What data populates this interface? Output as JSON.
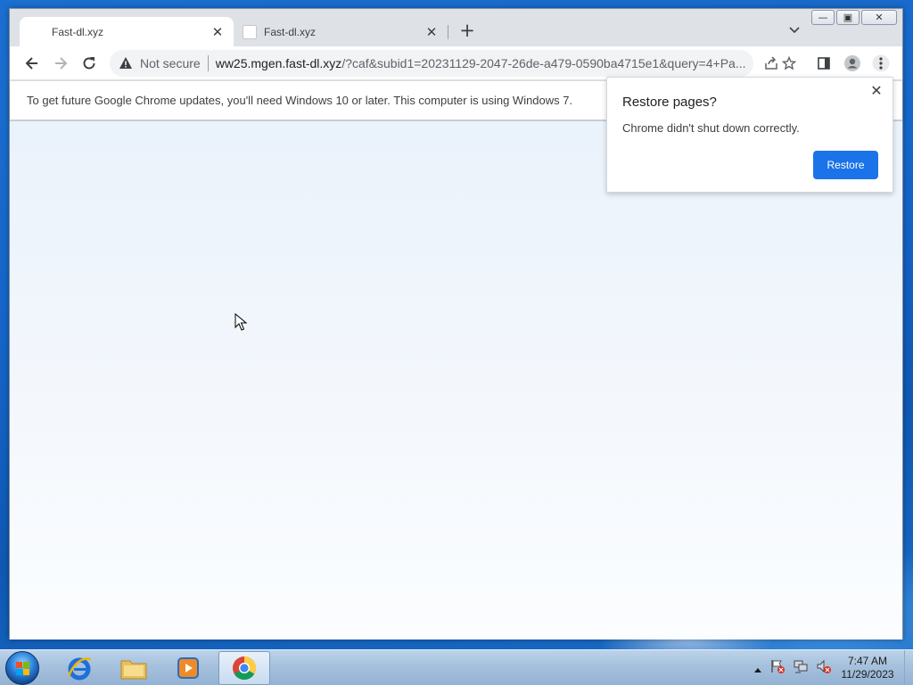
{
  "browser": {
    "tabs": [
      {
        "title": "Fast-dl.xyz",
        "active": true
      },
      {
        "title": "Fast-dl.xyz",
        "active": false
      }
    ],
    "address": {
      "security_label": "Not secure",
      "url_domain": "ww25.mgen.fast-dl.xyz",
      "url_rest": "/?caf&subid1=20231129-2047-26de-a479-0590ba4715e1&query=4+Pa..."
    },
    "infobar_text": "To get future Google Chrome updates, you'll need Windows 10 or later. This computer is using Windows 7.",
    "restore_popup": {
      "title": "Restore pages?",
      "body": "Chrome didn't shut down correctly.",
      "button": "Restore"
    }
  },
  "taskbar": {
    "clock_time": "7:47 AM",
    "clock_date": "11/29/2023"
  },
  "colors": {
    "accent": "#1a73e8",
    "tab_bar": "#dee1e6",
    "page_bg": "#f3f7fc"
  },
  "icons": [
    "back-icon",
    "forward-icon",
    "reload-icon",
    "warning-icon",
    "share-icon",
    "star-icon",
    "side-panel-icon",
    "profile-icon",
    "menu-icon",
    "close-icon",
    "chevron-down-icon",
    "plus-icon"
  ]
}
